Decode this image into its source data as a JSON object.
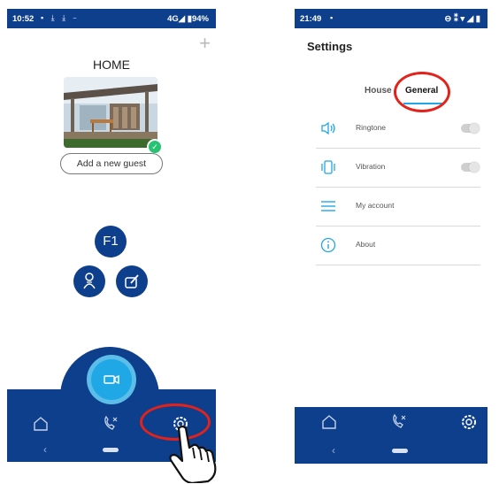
{
  "left_phone": {
    "status_bar": {
      "time": "10:52",
      "icons": "▪ ⤓ ⤓ ⎯",
      "network": "4G◢ ▮94%"
    },
    "add_icon": "+",
    "home_title": "HOME",
    "add_guest_label": "Add a new guest",
    "f1_label": "F1",
    "nav": {
      "items": [
        "home-icon",
        "call-history-icon",
        "settings-icon"
      ],
      "back": "‹"
    }
  },
  "right_phone": {
    "status_bar": {
      "time": "21:49",
      "icons": "▪",
      "network": "⊖ ⁑ ▾ ◢ ▮"
    },
    "title": "Settings",
    "tabs": [
      {
        "label": "House",
        "active": false
      },
      {
        "label": "General",
        "active": true
      }
    ],
    "rows": [
      {
        "label": "Ringtone",
        "icon": "speaker-icon",
        "toggle": false
      },
      {
        "label": "Vibration",
        "icon": "vibration-icon",
        "toggle": false
      },
      {
        "label": "My account",
        "icon": "menu-icon"
      },
      {
        "label": "About",
        "icon": "info-icon"
      }
    ],
    "nav": {
      "items": [
        "home-icon",
        "call-history-icon",
        "settings-icon"
      ],
      "back": "‹"
    }
  },
  "colors": {
    "brand_blue": "#0d3f8c",
    "accent_cyan": "#1fa7e6",
    "highlight_red": "#e2221b",
    "success_green": "#27c272"
  }
}
